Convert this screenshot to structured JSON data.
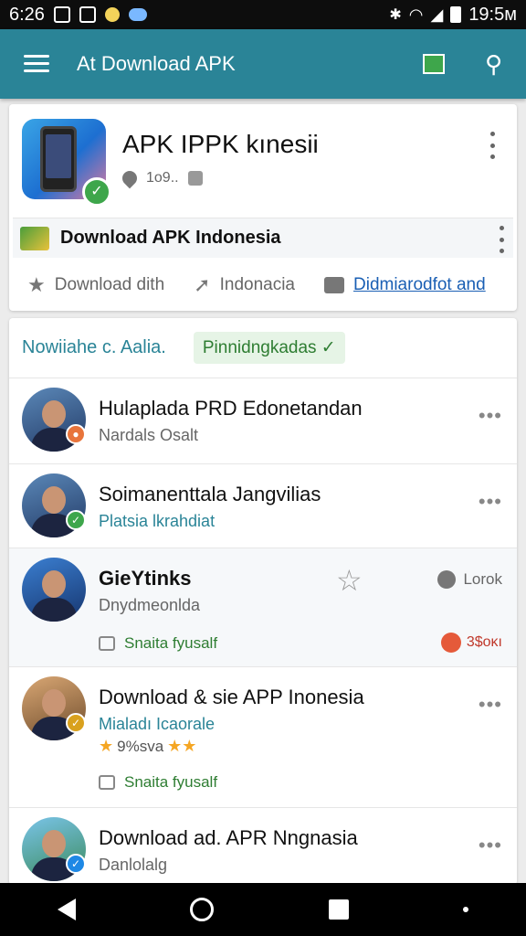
{
  "status": {
    "left_time": "6:26",
    "right_time": "19:5м"
  },
  "appbar": {
    "title": "At Download APK"
  },
  "app_card": {
    "title": "APK IPPK kınesii",
    "meta": "1o9..",
    "download_label": "Download APK Indonesia",
    "actions": {
      "download": "Download dith",
      "indonesia": "Indonacia",
      "link": "Didmiarodfot and"
    }
  },
  "filter": {
    "label": "Nowiiahe c. Aalia.",
    "chip": "Pinnidngkadas ✓"
  },
  "items": [
    {
      "title": "Hulaplada PRD Edonetandan",
      "subtitle": "Nardals Osalt"
    },
    {
      "title": "Soimanenttala Jangvilias",
      "subtitle": "Platsia lkrahdiat"
    },
    {
      "title": "GieYtinks",
      "subtitle": "Dnydmeonlda",
      "right": "Lorok",
      "meta": "Snaita fyusalf",
      "reaction": "3$oκı"
    },
    {
      "title": "Download & sie APP Inonesia",
      "subtitle": "Mialadı Icaorale",
      "rating": "9%sva",
      "meta": "Snaita fyusalf"
    },
    {
      "title": "Download ad. APR Nngnasia",
      "subtitle": "Danlolalg"
    }
  ]
}
